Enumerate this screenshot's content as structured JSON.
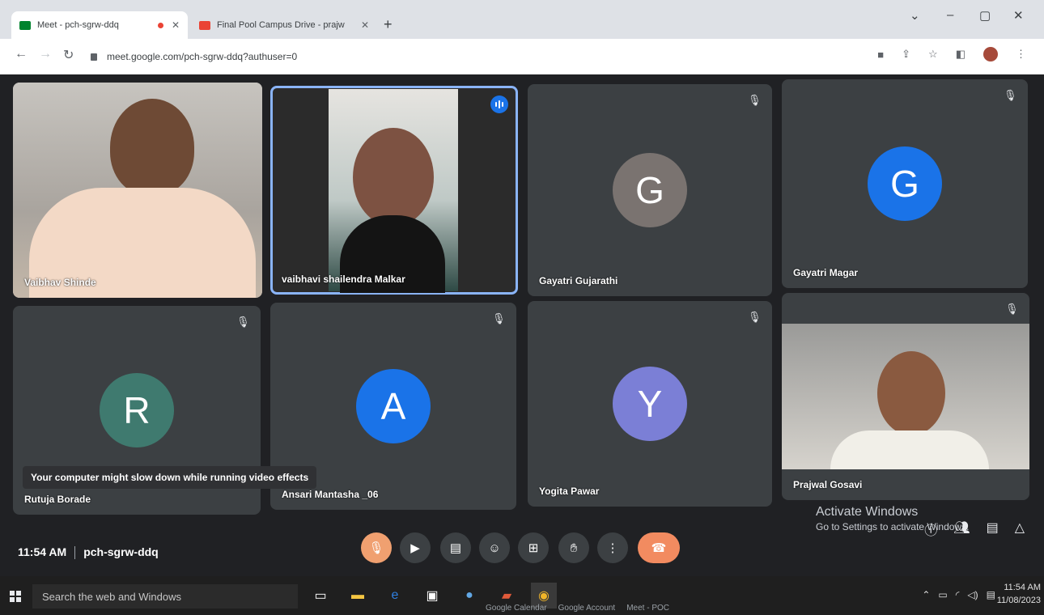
{
  "browser": {
    "tabs": [
      {
        "title": "Meet - pch-sgrw-ddq",
        "active": true,
        "recording": true
      },
      {
        "title": "Final Pool Campus Drive - prajw",
        "active": false
      }
    ],
    "new_tab": "+",
    "url": "meet.google.com/pch-sgrw-ddq?authuser=0"
  },
  "meet": {
    "tiles": [
      {
        "name": "Vaibhav Shinde",
        "type": "video",
        "muted": false
      },
      {
        "name": "vaibhavi shailendra Malkar",
        "type": "video",
        "speaking": true
      },
      {
        "name": "Gayatri Gujarathi",
        "type": "avatar",
        "initial": "G",
        "color": "#7a7370",
        "muted": true
      },
      {
        "name": "Gayatri Magar",
        "type": "avatar",
        "initial": "G",
        "color": "#1a73e8",
        "muted": true
      },
      {
        "name": "Rutuja Borade",
        "type": "avatar",
        "initial": "R",
        "color": "#3f7a6f",
        "muted": true
      },
      {
        "name": "Ansari Mantasha _06",
        "type": "avatar",
        "initial": "A",
        "color": "#1a73e8",
        "muted": true
      },
      {
        "name": "Yogita Pawar",
        "type": "avatar",
        "initial": "Y",
        "color": "#7b7fd6",
        "muted": true
      },
      {
        "name": "Prajwal Gosavi",
        "type": "video",
        "muted": true
      }
    ],
    "toast": "Your computer might slow down while running video effects",
    "time": "11:54 AM",
    "meeting_code": "pch-sgrw-ddq",
    "controls": [
      "mic-off",
      "camera",
      "captions",
      "emoji",
      "present",
      "raise-hand",
      "more",
      "end-call"
    ]
  },
  "windows": {
    "activate_title": "Activate Windows",
    "activate_sub": "Go to Settings to activate Windows.",
    "search_placeholder": "Search the web and Windows",
    "clock_time": "11:54 AM",
    "clock_date": "11/08/2023"
  },
  "ghost_tabs": [
    "Google Calendar",
    "Google Account",
    "Meet - POC"
  ]
}
